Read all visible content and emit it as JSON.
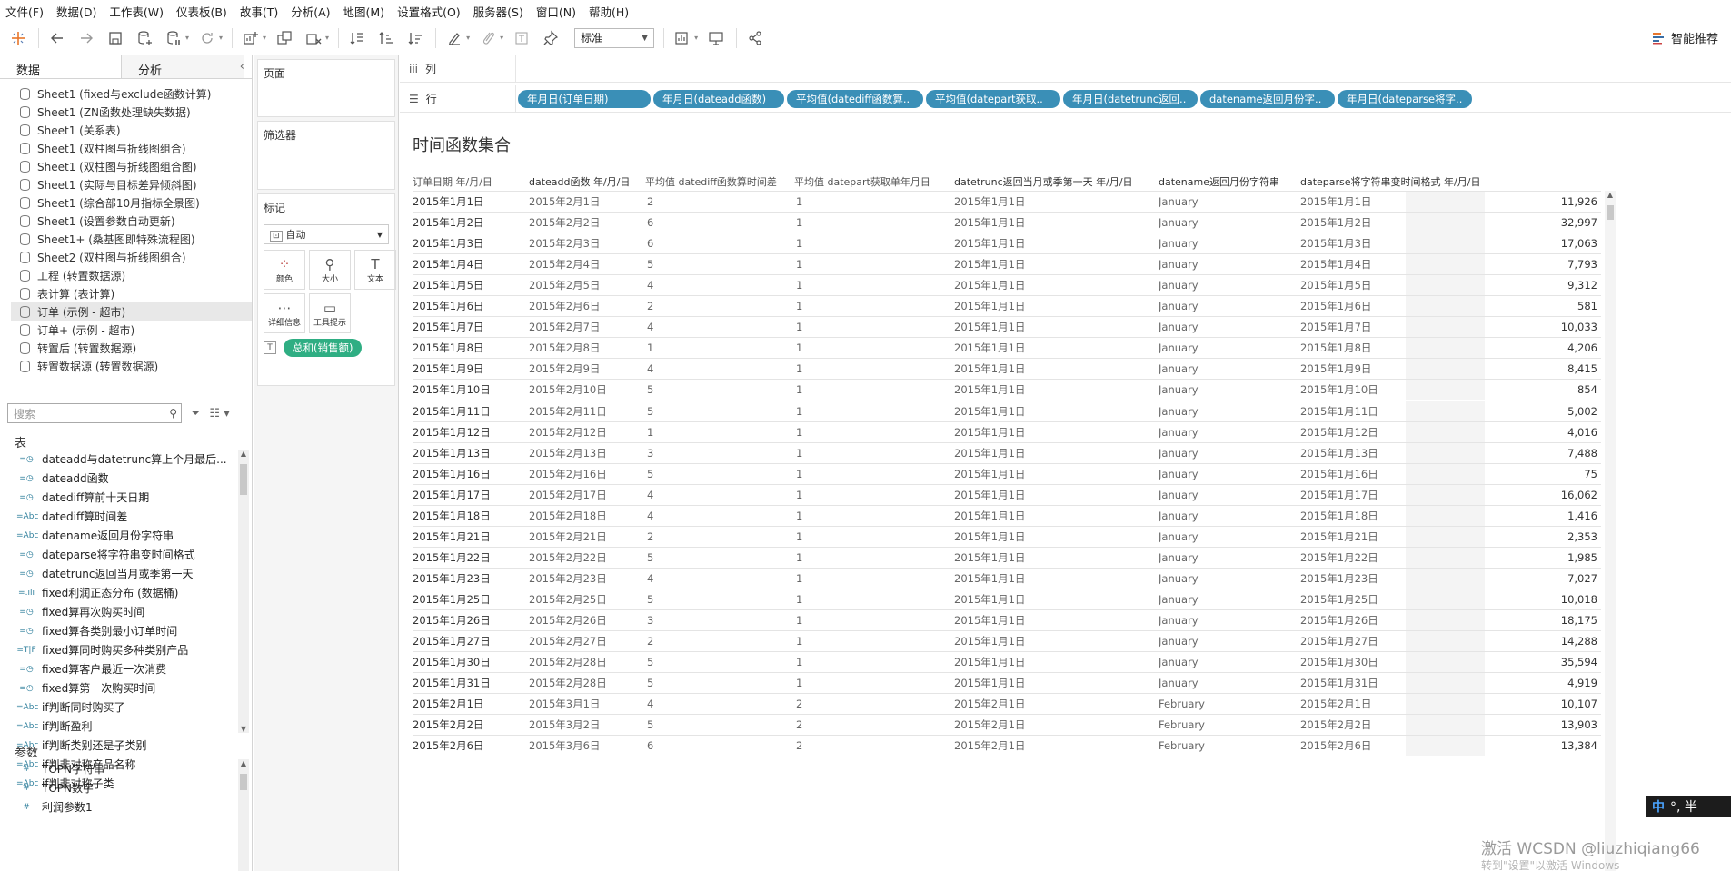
{
  "menu": [
    "文件(F)",
    "数据(D)",
    "工作表(W)",
    "仪表板(B)",
    "故事(T)",
    "分析(A)",
    "地图(M)",
    "设置格式(O)",
    "服务器(S)",
    "窗口(N)",
    "帮助(H)"
  ],
  "toolbar": {
    "fit_select": "标准",
    "smart_recommend": "智能推荐",
    "icons": [
      "tableau-logo-icon",
      "undo-icon",
      "redo-icon",
      "save-icon",
      "new-datasource-icon",
      "pause-update-icon",
      "refresh-icon",
      "new-worksheet-icon",
      "duplicate-sheet-icon",
      "clear-sheet-icon",
      "swap-icon",
      "sort-ascending-icon",
      "sort-descending-icon",
      "highlight-icon",
      "group-icon",
      "label-icon",
      "pin-icon",
      "show-me-icon",
      "presentation-icon",
      "share-icon"
    ]
  },
  "left_pane": {
    "tabs": [
      "数据",
      "分析"
    ],
    "datasources": [
      "Sheet1 (fixed与exclude函数计算)",
      "Sheet1 (ZN函数处理缺失数据)",
      "Sheet1 (关系表)",
      "Sheet1 (双柱图与折线图组合)",
      "Sheet1 (双柱图与折线图组合图)",
      "Sheet1 (实际与目标差异倾斜图)",
      "Sheet1 (综合部10月指标全景图)",
      "Sheet1 (设置参数自动更新)",
      "Sheet1+ (桑基图即特殊流程图)",
      "Sheet2 (双柱图与折线图组合)",
      "工程 (转置数据源)",
      "表计算 (表计算)",
      "订单 (示例 - 超市)",
      "订单+ (示例 - 超市)",
      "转置后 (转置数据源)",
      "转置数据源 (转置数据源)"
    ],
    "selected_datasource_index": 12,
    "search_placeholder": "搜索",
    "tables_label": "表",
    "fields": [
      {
        "type": "=◷",
        "name": "dateadd与datetrunc算上个月最后..."
      },
      {
        "type": "=◷",
        "name": "dateadd函数"
      },
      {
        "type": "=◷",
        "name": "datediff算前十天日期"
      },
      {
        "type": "=Abc",
        "name": "datediff算时间差"
      },
      {
        "type": "=Abc",
        "name": "datename返回月份字符串"
      },
      {
        "type": "=◷",
        "name": "dateparse将字符串变时间格式"
      },
      {
        "type": "=◷",
        "name": "datetrunc返回当月或季第一天"
      },
      {
        "type": "=.ılı",
        "name": "fixed利润正态分布 (数据桶)"
      },
      {
        "type": "=◷",
        "name": "fixed算再次购买时间"
      },
      {
        "type": "=◷",
        "name": "fixed算各类别最小订单时间"
      },
      {
        "type": "=T|F",
        "name": "fixed算同时购买多种类别产品"
      },
      {
        "type": "=◷",
        "name": "fixed算客户最近一次消费"
      },
      {
        "type": "=◷",
        "name": "fixed算第一次购买时间"
      },
      {
        "type": "=Abc",
        "name": "if判断同时购买了"
      },
      {
        "type": "=Abc",
        "name": "if判断盈利"
      },
      {
        "type": "=Abc",
        "name": "if判断类别还是子类别"
      },
      {
        "type": "=Abc",
        "name": "if判非对称产品名称"
      },
      {
        "type": "=Abc",
        "name": "if判非对称子类"
      }
    ],
    "params_label": "参数",
    "params": [
      {
        "type": "#",
        "name": "TOPN字符串"
      },
      {
        "type": "#",
        "name": "TOPN数字"
      },
      {
        "type": "#",
        "name": "利润参数1"
      }
    ]
  },
  "shelves": {
    "pages_label": "页面",
    "filters_label": "筛选器",
    "marks_label": "标记",
    "marks_type": "自动",
    "marks_buttons": [
      {
        "icon": "color-icon",
        "label": "颜色"
      },
      {
        "icon": "size-icon",
        "label": "大小"
      },
      {
        "icon": "text-icon",
        "label": "文本"
      },
      {
        "icon": "detail-icon",
        "label": "详细信息"
      },
      {
        "icon": "tooltip-icon",
        "label": "工具提示"
      }
    ],
    "sum_pill": "总和(销售额)",
    "columns_label": "列",
    "rows_label": "行",
    "row_pills": [
      "年月日(订单日期)",
      "年月日(dateadd函数)",
      "平均值(datediff函数算..",
      "平均值(datepart获取..",
      "年月日(datetrunc返回..",
      "datename返回月份字..",
      "年月日(dateparse将字.."
    ]
  },
  "viz": {
    "title": "时间函数集合",
    "headers": [
      "订单日期 年/月/日",
      "dateadd函数 年/月/日",
      "平均值 datediff函数算时间差",
      "平均值 datepart获取单年月日",
      "datetrunc返回当月或季第一天 年/月/日",
      "datename返回月份字符串",
      "dateparse将字符串变时间格式 年/月/日"
    ],
    "rows": [
      [
        "2015年1月1日",
        "2015年2月1日",
        "2",
        "1",
        "2015年1月1日",
        "January",
        "2015年1月1日",
        "11,926"
      ],
      [
        "2015年1月2日",
        "2015年2月2日",
        "6",
        "1",
        "2015年1月1日",
        "January",
        "2015年1月2日",
        "32,997"
      ],
      [
        "2015年1月3日",
        "2015年2月3日",
        "6",
        "1",
        "2015年1月1日",
        "January",
        "2015年1月3日",
        "17,063"
      ],
      [
        "2015年1月4日",
        "2015年2月4日",
        "5",
        "1",
        "2015年1月1日",
        "January",
        "2015年1月4日",
        "7,793"
      ],
      [
        "2015年1月5日",
        "2015年2月5日",
        "4",
        "1",
        "2015年1月1日",
        "January",
        "2015年1月5日",
        "9,312"
      ],
      [
        "2015年1月6日",
        "2015年2月6日",
        "2",
        "1",
        "2015年1月1日",
        "January",
        "2015年1月6日",
        "581"
      ],
      [
        "2015年1月7日",
        "2015年2月7日",
        "4",
        "1",
        "2015年1月1日",
        "January",
        "2015年1月7日",
        "10,033"
      ],
      [
        "2015年1月8日",
        "2015年2月8日",
        "1",
        "1",
        "2015年1月1日",
        "January",
        "2015年1月8日",
        "4,206"
      ],
      [
        "2015年1月9日",
        "2015年2月9日",
        "4",
        "1",
        "2015年1月1日",
        "January",
        "2015年1月9日",
        "8,415"
      ],
      [
        "2015年1月10日",
        "2015年2月10日",
        "5",
        "1",
        "2015年1月1日",
        "January",
        "2015年1月10日",
        "854"
      ],
      [
        "2015年1月11日",
        "2015年2月11日",
        "5",
        "1",
        "2015年1月1日",
        "January",
        "2015年1月11日",
        "5,002"
      ],
      [
        "2015年1月12日",
        "2015年2月12日",
        "1",
        "1",
        "2015年1月1日",
        "January",
        "2015年1月12日",
        "4,016"
      ],
      [
        "2015年1月13日",
        "2015年2月13日",
        "3",
        "1",
        "2015年1月1日",
        "January",
        "2015年1月13日",
        "7,488"
      ],
      [
        "2015年1月16日",
        "2015年2月16日",
        "5",
        "1",
        "2015年1月1日",
        "January",
        "2015年1月16日",
        "75"
      ],
      [
        "2015年1月17日",
        "2015年2月17日",
        "4",
        "1",
        "2015年1月1日",
        "January",
        "2015年1月17日",
        "16,062"
      ],
      [
        "2015年1月18日",
        "2015年2月18日",
        "4",
        "1",
        "2015年1月1日",
        "January",
        "2015年1月18日",
        "1,416"
      ],
      [
        "2015年1月21日",
        "2015年2月21日",
        "2",
        "1",
        "2015年1月1日",
        "January",
        "2015年1月21日",
        "2,353"
      ],
      [
        "2015年1月22日",
        "2015年2月22日",
        "5",
        "1",
        "2015年1月1日",
        "January",
        "2015年1月22日",
        "1,985"
      ],
      [
        "2015年1月23日",
        "2015年2月23日",
        "4",
        "1",
        "2015年1月1日",
        "January",
        "2015年1月23日",
        "7,027"
      ],
      [
        "2015年1月25日",
        "2015年2月25日",
        "5",
        "1",
        "2015年1月1日",
        "January",
        "2015年1月25日",
        "10,018"
      ],
      [
        "2015年1月26日",
        "2015年2月26日",
        "3",
        "1",
        "2015年1月1日",
        "January",
        "2015年1月26日",
        "18,175"
      ],
      [
        "2015年1月27日",
        "2015年2月27日",
        "2",
        "1",
        "2015年1月1日",
        "January",
        "2015年1月27日",
        "14,288"
      ],
      [
        "2015年1月30日",
        "2015年2月28日",
        "5",
        "1",
        "2015年1月1日",
        "January",
        "2015年1月30日",
        "35,594"
      ],
      [
        "2015年1月31日",
        "2015年2月28日",
        "5",
        "1",
        "2015年1月1日",
        "January",
        "2015年1月31日",
        "4,919"
      ],
      [
        "2015年2月1日",
        "2015年3月1日",
        "4",
        "2",
        "2015年2月1日",
        "February",
        "2015年2月1日",
        "10,107"
      ],
      [
        "2015年2月2日",
        "2015年3月2日",
        "5",
        "2",
        "2015年2月1日",
        "February",
        "2015年2月2日",
        "13,903"
      ],
      [
        "2015年2月6日",
        "2015年3月6日",
        "6",
        "2",
        "2015年2月1日",
        "February",
        "2015年2月6日",
        "13,384"
      ]
    ]
  },
  "ime": {
    "lang": "中",
    "text": "°, 半"
  },
  "watermark": {
    "line1": "激活 WCSDN @liuzhiqiang66",
    "line2": "转到\"设置\"以激活 Windows"
  }
}
